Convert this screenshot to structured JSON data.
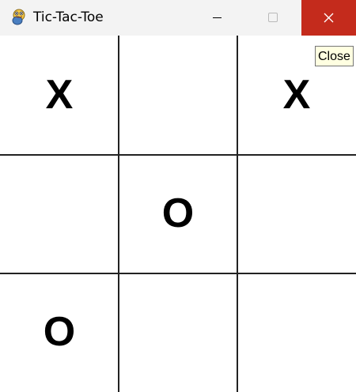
{
  "window": {
    "title": "Tic-Tac-Toe",
    "icon": "pygame-snake-icon",
    "controls": {
      "minimize": "minimize-icon",
      "maximize": "maximize-icon",
      "close": "close-icon"
    },
    "close_color": "#c42b1c"
  },
  "tooltip": {
    "text": "Close"
  },
  "board": {
    "cells": [
      "X",
      "",
      "X",
      "",
      "O",
      "",
      "O",
      "",
      ""
    ]
  }
}
